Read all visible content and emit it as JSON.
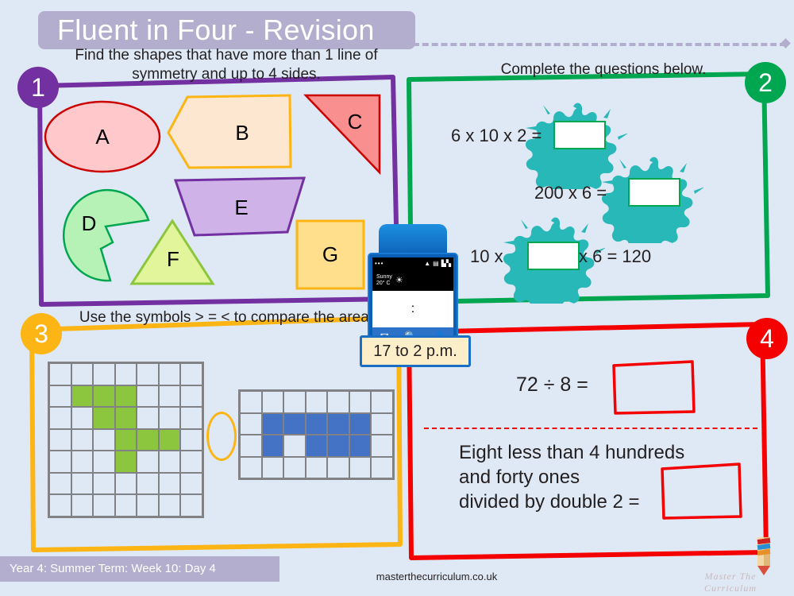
{
  "header": {
    "title": "Fluent in Four - Revision"
  },
  "panels": [
    {
      "number": "1",
      "color": "#7230a0",
      "instruction": "Find the shapes that have more than 1 line of symmetry and up to 4 sides.",
      "shapes": [
        {
          "label": "A",
          "name": "ellipse",
          "fill": "#ffc9cc",
          "stroke": "#cc0000"
        },
        {
          "label": "B",
          "name": "pentagon-arrow",
          "fill": "#fde7d0",
          "stroke": "#fcb514"
        },
        {
          "label": "C",
          "name": "right-triangle",
          "fill": "#f98f8f",
          "stroke": "#cc0000"
        },
        {
          "label": "D",
          "name": "pac-man-sector",
          "fill": "#b6f2b6",
          "stroke": "#00a650"
        },
        {
          "label": "E",
          "name": "trapezium",
          "fill": "#cfb3e8",
          "stroke": "#7230a0"
        },
        {
          "label": "F",
          "name": "triangle",
          "fill": "#e3f59a",
          "stroke": "#8cc63f"
        },
        {
          "label": "G",
          "name": "square",
          "fill": "#ffdf8c",
          "stroke": "#fcb514"
        }
      ]
    },
    {
      "number": "2",
      "color": "#00a650",
      "instruction": "Complete the questions below.",
      "questions": [
        {
          "before": "6 x 10 x 2 =",
          "answer": "",
          "after": ""
        },
        {
          "before": "200 x 6 =",
          "answer": "",
          "after": ""
        },
        {
          "before": "10 x",
          "answer": "",
          "after": "x 6 = 120"
        }
      ]
    },
    {
      "number": "3",
      "color": "#fcb514",
      "instruction": "Use the symbols > = < to compare the area.",
      "comparison_answer": "",
      "grids": [
        {
          "name": "green-grid",
          "cols": 7,
          "rows": 7,
          "fill_color": "#8cc63f",
          "filled": [
            [
              1,
              1
            ],
            [
              1,
              2
            ],
            [
              1,
              3
            ],
            [
              2,
              2
            ],
            [
              2,
              3
            ],
            [
              3,
              3
            ],
            [
              3,
              4
            ],
            [
              3,
              5
            ],
            [
              4,
              3
            ]
          ]
        },
        {
          "name": "blue-grid",
          "cols": 7,
          "rows": 4,
          "fill_color": "#4472c4",
          "filled": [
            [
              1,
              1
            ],
            [
              1,
              2
            ],
            [
              1,
              3
            ],
            [
              1,
              4
            ],
            [
              1,
              5
            ],
            [
              2,
              1
            ],
            [
              2,
              3
            ],
            [
              2,
              4
            ],
            [
              2,
              5
            ]
          ]
        }
      ]
    },
    {
      "number": "4",
      "color": "#f50000",
      "questions": [
        {
          "text": "72 ÷ 8 =",
          "answer": ""
        },
        {
          "text": "Eight less than 4 hundreds\nand forty ones\ndivided by double 2 =",
          "answer": ""
        }
      ]
    }
  ],
  "phone_widget": {
    "status_dots": "•••",
    "wifi_icon": "wifi-icon",
    "battery_icon": "battery-icon",
    "signal_icon": "signal-icon",
    "weather_text": "Sunny\n20° C",
    "sun_icon": "sun-icon",
    "screen_text": ":",
    "nav_icons": [
      "envelope-icon",
      "magnifier-icon",
      "contact-icon"
    ],
    "time_callout": "17 to 2 p.m."
  },
  "footer": {
    "lesson": "Year 4: Summer Term: Week 10: Day 4",
    "url": "masterthecurriculum.co.uk",
    "brand": "Master The Curriculum"
  }
}
